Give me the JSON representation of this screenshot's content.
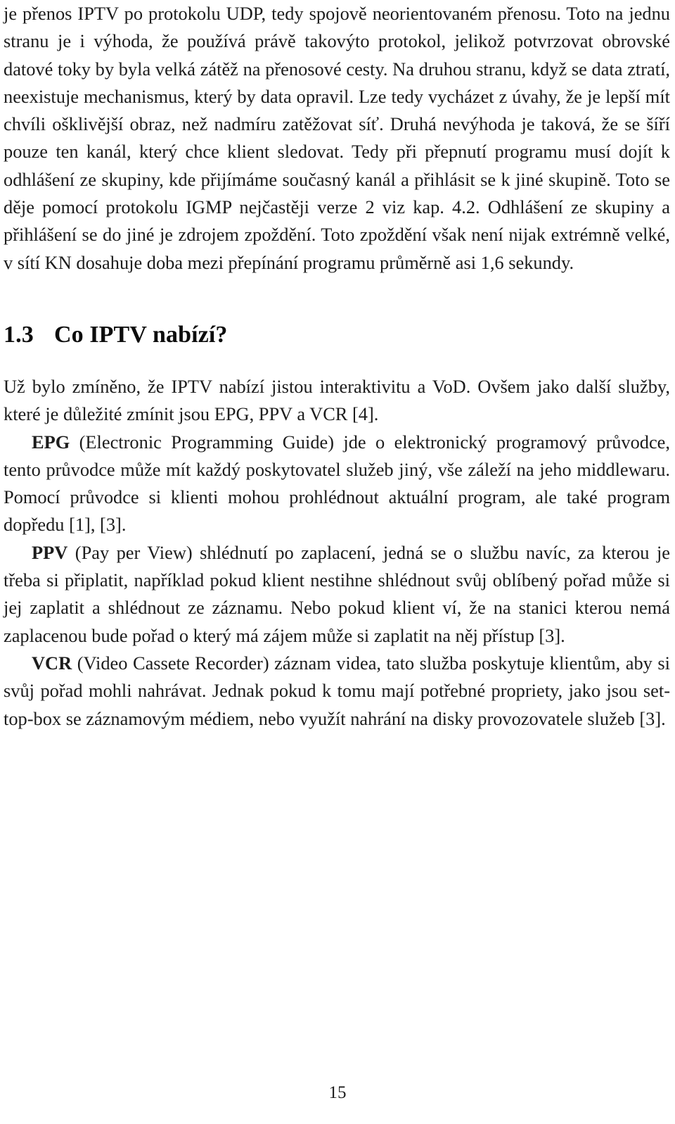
{
  "document": {
    "language": "cs",
    "page_number": "15",
    "text_color": "#1c1c1c",
    "background_color": "#ffffff"
  },
  "body": {
    "paragraph_continued": "je přenos IPTV po protokolu UDP, tedy spojově neorientovaném přenosu. Toto na jednu stranu je i výhoda, že používá právě takovýto protokol, jelikož potvrzovat obrovské datové toky by byla velká zátěž na přenosové cesty. Na druhou stranu, když se data ztratí, neexistuje mechanismus, který by data opravil. Lze tedy vycházet z úvahy, že je lepší mít chvíli ošklivější obraz, než nadmíru zatěžovat síť. Druhá nevýhoda je taková, že se šíří pouze ten kanál, který chce klient sledovat. Tedy při přepnutí programu musí dojít k odhlášení ze skupiny, kde přijímáme současný kanál a přihlásit se k jiné skupině. Toto se děje pomocí protokolu IGMP nejčastěji verze 2 viz kap. 4.2. Odhlášení ze skupiny a přihlášení se do jiné je zdrojem zpoždění. Toto zpoždění však není nijak extrémně velké, v sítí KN dosahuje doba mezi přepínání programu průměrně asi 1,6 sekundy."
  },
  "section": {
    "number": "1.3",
    "title": "Co IPTV nabízí?"
  },
  "paragraphs": [
    {
      "id": "intro",
      "lead_in": "",
      "text": "Už bylo zmíněno, že IPTV nabízí jistou interaktivitu a VoD. Ovšem jako další služby, které je důležité zmínit jsou EPG, PPV a VCR [4]."
    },
    {
      "id": "epg",
      "lead_in": "EPG",
      "text": " (Electronic Programming Guide) jde o elektronický programový průvodce, tento průvodce může mít každý poskytovatel služeb jiný, vše záleží na jeho middlewaru. Pomocí průvodce si klienti mohou prohlédnout aktuální program, ale také program dopředu [1], [3]."
    },
    {
      "id": "ppv",
      "lead_in": "PPV",
      "text": " (Pay per View) shlédnutí po zaplacení, jedná se o službu navíc, za kterou je třeba si připlatit, například pokud klient nestihne shlédnout svůj oblíbený pořad může si jej zaplatit a shlédnout ze záznamu. Nebo pokud klient ví, že na stanici kterou nemá zaplacenou bude pořad o který má zájem může si zaplatit na něj přístup [3]."
    },
    {
      "id": "vcr",
      "lead_in": "VCR",
      "text": " (Video Cassete Recorder) záznam videa, tato služba poskytuje klientům, aby si svůj pořad mohli nahrávat. Jednak pokud k tomu mají potřebné propriety, jako jsou set-top-box se záznamovým médiem, nebo využít nahrání na disky provozovatele služeb [3]."
    }
  ]
}
